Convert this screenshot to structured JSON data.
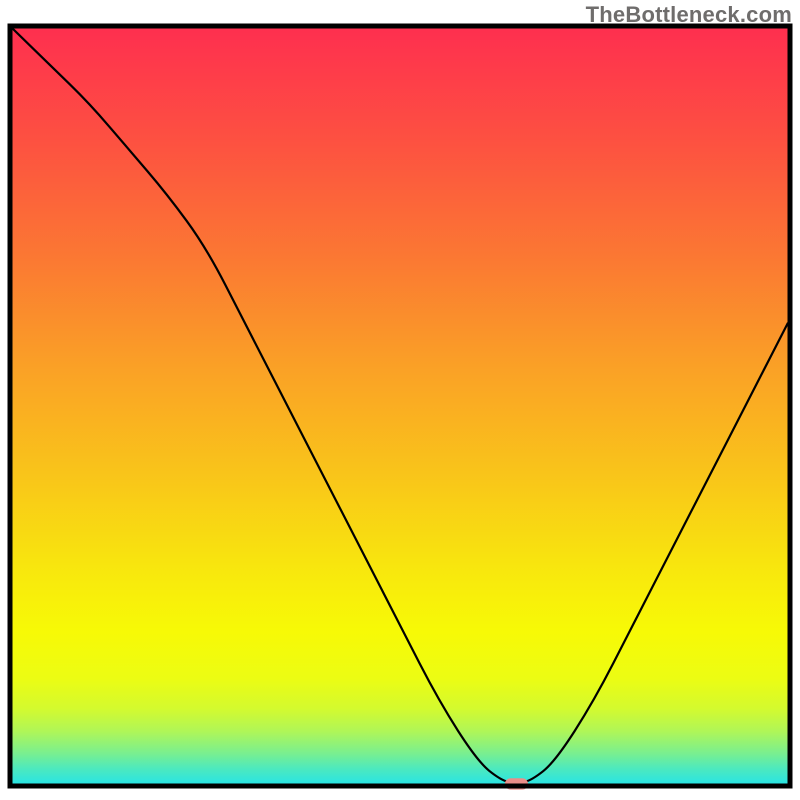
{
  "watermark": {
    "text": "TheBottleneck.com"
  },
  "chart_data": {
    "type": "line",
    "title": "",
    "xlabel": "",
    "ylabel": "",
    "xlim": [
      0,
      100
    ],
    "ylim": [
      0,
      100
    ],
    "x": [
      0,
      5,
      10,
      15,
      20,
      25,
      30,
      35,
      40,
      45,
      50,
      55,
      60,
      63,
      65,
      67,
      70,
      75,
      80,
      85,
      90,
      95,
      100
    ],
    "values": [
      100,
      95,
      90,
      84,
      78,
      71,
      61,
      51,
      41,
      31,
      21,
      11,
      3,
      0.5,
      0,
      0.5,
      3,
      11,
      21,
      31,
      41,
      51,
      61
    ],
    "marker": {
      "x": 65,
      "y": 0,
      "color": "#e98e89",
      "width_pct": 3,
      "height_pct": 1.5
    },
    "gradient_stops": [
      {
        "offset": 0,
        "color": "#fe2f4f"
      },
      {
        "offset": 15,
        "color": "#fd5141"
      },
      {
        "offset": 30,
        "color": "#fb7733"
      },
      {
        "offset": 45,
        "color": "#faa126"
      },
      {
        "offset": 60,
        "color": "#f9c719"
      },
      {
        "offset": 72,
        "color": "#f8e80d"
      },
      {
        "offset": 80,
        "color": "#f7fa06"
      },
      {
        "offset": 86,
        "color": "#ecfc13"
      },
      {
        "offset": 90,
        "color": "#d4fa2e"
      },
      {
        "offset": 93,
        "color": "#b0f657"
      },
      {
        "offset": 96,
        "color": "#78ef91"
      },
      {
        "offset": 98,
        "color": "#4ce9bf"
      },
      {
        "offset": 100,
        "color": "#29e4e4"
      }
    ],
    "border_color": "#000000"
  }
}
